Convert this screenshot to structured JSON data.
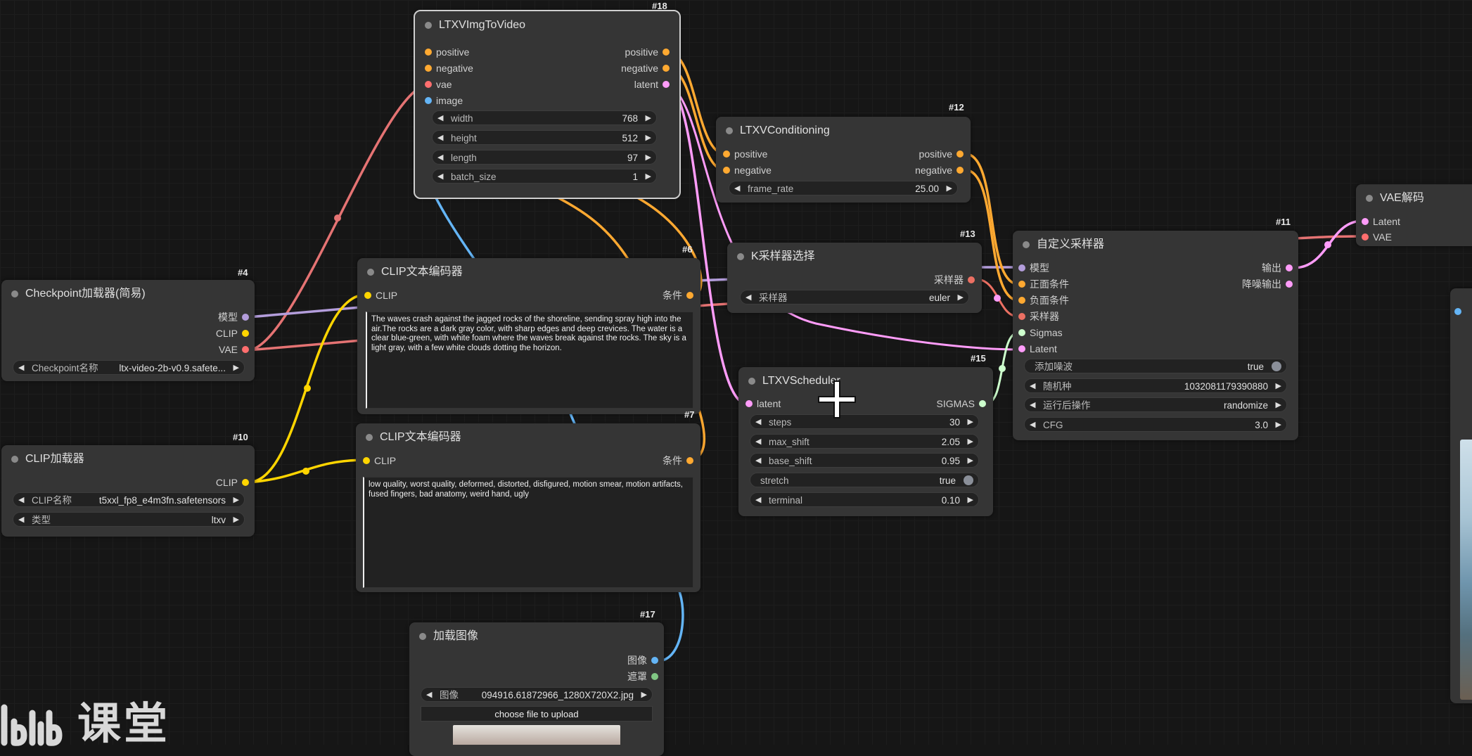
{
  "colors": {
    "model": "#b39ddb",
    "clip": "#ffd500",
    "vae": "#ff6e6e",
    "conditioning": "#ffa931",
    "latent": "#ff9cf9",
    "image": "#64b5f6",
    "mask": "#81c784",
    "sigmas": "#cdffcd",
    "sampler": "#ec7063",
    "links_red": "#e57373"
  },
  "nodes": {
    "ltxvimgtovideo": {
      "id": "#18",
      "title": "LTXVImgToVideo",
      "inputs": [
        "positive",
        "negative",
        "vae",
        "image"
      ],
      "outputs": [
        "positive",
        "negative",
        "latent"
      ],
      "widgets": [
        {
          "label": "width",
          "value": "768"
        },
        {
          "label": "height",
          "value": "512"
        },
        {
          "label": "length",
          "value": "97"
        },
        {
          "label": "batch_size",
          "value": "1"
        }
      ]
    },
    "ltxvconditioning": {
      "id": "#12",
      "title": "LTXVConditioning",
      "inputs": [
        "positive",
        "negative"
      ],
      "outputs": [
        "positive",
        "negative"
      ],
      "widgets": [
        {
          "label": "frame_rate",
          "value": "25.00"
        }
      ]
    },
    "ksamplerselect": {
      "id": "#13",
      "title": "K采样器选择",
      "outputs": [
        "采样器"
      ],
      "widgets": [
        {
          "label": "采样器",
          "value": "euler"
        }
      ]
    },
    "ltxvscheduler": {
      "id": "#15",
      "title": "LTXVScheduler",
      "inputs": [
        "latent"
      ],
      "outputs": [
        "SIGMAS"
      ],
      "widgets": [
        {
          "label": "steps",
          "value": "30"
        },
        {
          "label": "max_shift",
          "value": "2.05"
        },
        {
          "label": "base_shift",
          "value": "0.95"
        },
        {
          "label": "stretch",
          "value": "true"
        },
        {
          "label": "terminal",
          "value": "0.10"
        }
      ]
    },
    "customsampler": {
      "id": "#11",
      "title": "自定义采样器",
      "inputs": [
        "模型",
        "正面条件",
        "负面条件",
        "采样器",
        "Sigmas",
        "Latent"
      ],
      "outputs": [
        "输出",
        "降噪输出"
      ],
      "widgets": [
        {
          "label": "添加噪波",
          "value": "true"
        },
        {
          "label": "随机种",
          "value": "1032081179390880"
        },
        {
          "label": "运行后操作",
          "value": "randomize"
        },
        {
          "label": "CFG",
          "value": "3.0"
        }
      ]
    },
    "vaedecode": {
      "title": "VAE解码",
      "inputs": [
        "Latent",
        "VAE"
      ]
    },
    "checkpoint": {
      "id": "#4",
      "title": "Checkpoint加载器(简易)",
      "outputs": [
        "模型",
        "CLIP",
        "VAE"
      ],
      "widgets": [
        {
          "label": "Checkpoint名称",
          "value": "ltx-video-2b-v0.9.safete..."
        }
      ]
    },
    "clipencode_pos": {
      "id": "#6",
      "title": "CLIP文本编码器",
      "inputs": [
        "CLIP"
      ],
      "outputs": [
        "条件"
      ],
      "text": "The waves crash against the jagged rocks of the shoreline, sending spray high into the air.The rocks are a dark gray color, with sharp edges and deep crevices. The water is a clear blue-green, with white foam where the waves break against the rocks. The sky is a light gray, with a few white clouds dotting the horizon."
    },
    "clipencode_neg": {
      "id": "#7",
      "title": "CLIP文本编码器",
      "inputs": [
        "CLIP"
      ],
      "outputs": [
        "条件"
      ],
      "text": "low quality, worst quality, deformed, distorted, disfigured, motion smear, motion artifacts, fused fingers, bad anatomy, weird hand, ugly"
    },
    "cliploader": {
      "id": "#10",
      "title": "CLIP加载器",
      "outputs": [
        "CLIP"
      ],
      "widgets": [
        {
          "label": "CLIP名称",
          "value": "t5xxl_fp8_e4m3fn.safetensors"
        },
        {
          "label": "类型",
          "value": "ltxv"
        }
      ]
    },
    "loadimage": {
      "id": "#17",
      "title": "加载图像",
      "outputs": [
        "图像",
        "遮罩"
      ],
      "widgets": [
        {
          "label": "图像",
          "value": "094916.61872966_1280X720X2.jpg"
        }
      ],
      "upload_label": "choose file to upload"
    }
  },
  "watermark": "课堂"
}
